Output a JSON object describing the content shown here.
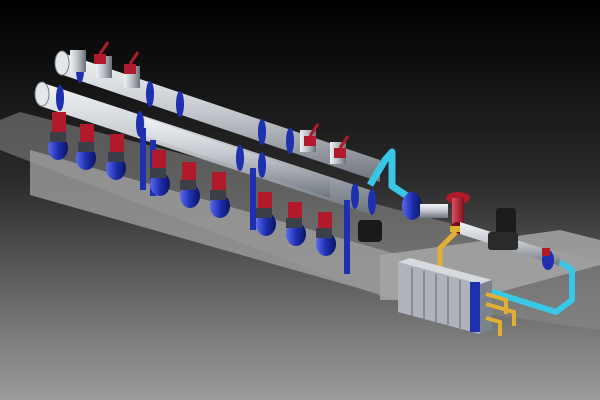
{
  "scene": {
    "colors": {
      "bg_top": "#000000",
      "bg_bottom": "#9a9a9a",
      "pipe_silver": "#c8ccd2",
      "pipe_dark": "#7d838b",
      "flange_blue": "#1e2fb0",
      "valve_red": "#b01a2a",
      "pump_blue": "#1d2aa8",
      "motor_black": "#1a1a1a",
      "cyan_pipe": "#38c8e6",
      "yellow_pipe": "#e0b030",
      "heat_exchanger": "#aeb3ba"
    }
  }
}
